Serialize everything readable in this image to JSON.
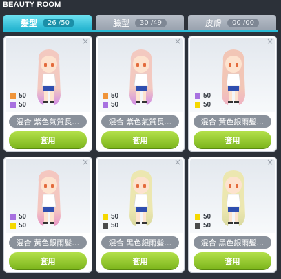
{
  "window": {
    "title": "BEAUTY ROOM"
  },
  "tabs": [
    {
      "label": "髮型",
      "count": "26 /50",
      "active": true
    },
    {
      "label": "臉型",
      "count": "30 /49",
      "active": false
    },
    {
      "label": "皮膚",
      "count": "00 /00",
      "active": false
    }
  ],
  "colors": {
    "orange": "#f0943a",
    "purple": "#a871e0",
    "yellow": "#f5d800",
    "black": "#4a4a4a",
    "accent": "#2bbad4",
    "apply_green": "#8cc426"
  },
  "cards": [
    {
      "swatches": [
        {
          "color": "orange",
          "value": "50"
        },
        {
          "color": "purple",
          "value": "50"
        }
      ],
      "label": "混合  紫色氣質長…",
      "apply": "套用",
      "hair": "#f3c9c0",
      "tip": "#d08be6"
    },
    {
      "swatches": [
        {
          "color": "orange",
          "value": "50"
        },
        {
          "color": "purple",
          "value": "50"
        }
      ],
      "label": "混合  紫色氣質長…",
      "apply": "套用",
      "hair": "#f3c9c0",
      "tip": "#d08be6"
    },
    {
      "swatches": [
        {
          "color": "purple",
          "value": "50"
        },
        {
          "color": "yellow",
          "value": "50"
        }
      ],
      "label": "混合  黃色銀雨髮…",
      "apply": "套用",
      "hair": "#f2c6b6",
      "tip": "#f0b3c4"
    },
    {
      "swatches": [
        {
          "color": "purple",
          "value": "50"
        },
        {
          "color": "yellow",
          "value": "50"
        }
      ],
      "label": "混合  黃色銀雨髮…",
      "apply": "套用",
      "hair": "#f4c7c0",
      "tip": "#e894c6"
    },
    {
      "swatches": [
        {
          "color": "yellow",
          "value": "50"
        },
        {
          "color": "black",
          "value": "50"
        }
      ],
      "label": "混合  黑色銀雨髮…",
      "apply": "套用",
      "hair": "#ece7b0",
      "tip": "#d9d9a0"
    },
    {
      "swatches": [
        {
          "color": "yellow",
          "value": "50"
        },
        {
          "color": "black",
          "value": "50"
        }
      ],
      "label": "混合  黑色銀雨髮…",
      "apply": "套用",
      "hair": "#ece7b0",
      "tip": "#d9d9a0"
    }
  ],
  "icons": {
    "close": "close-icon"
  },
  "close_glyph": "×"
}
